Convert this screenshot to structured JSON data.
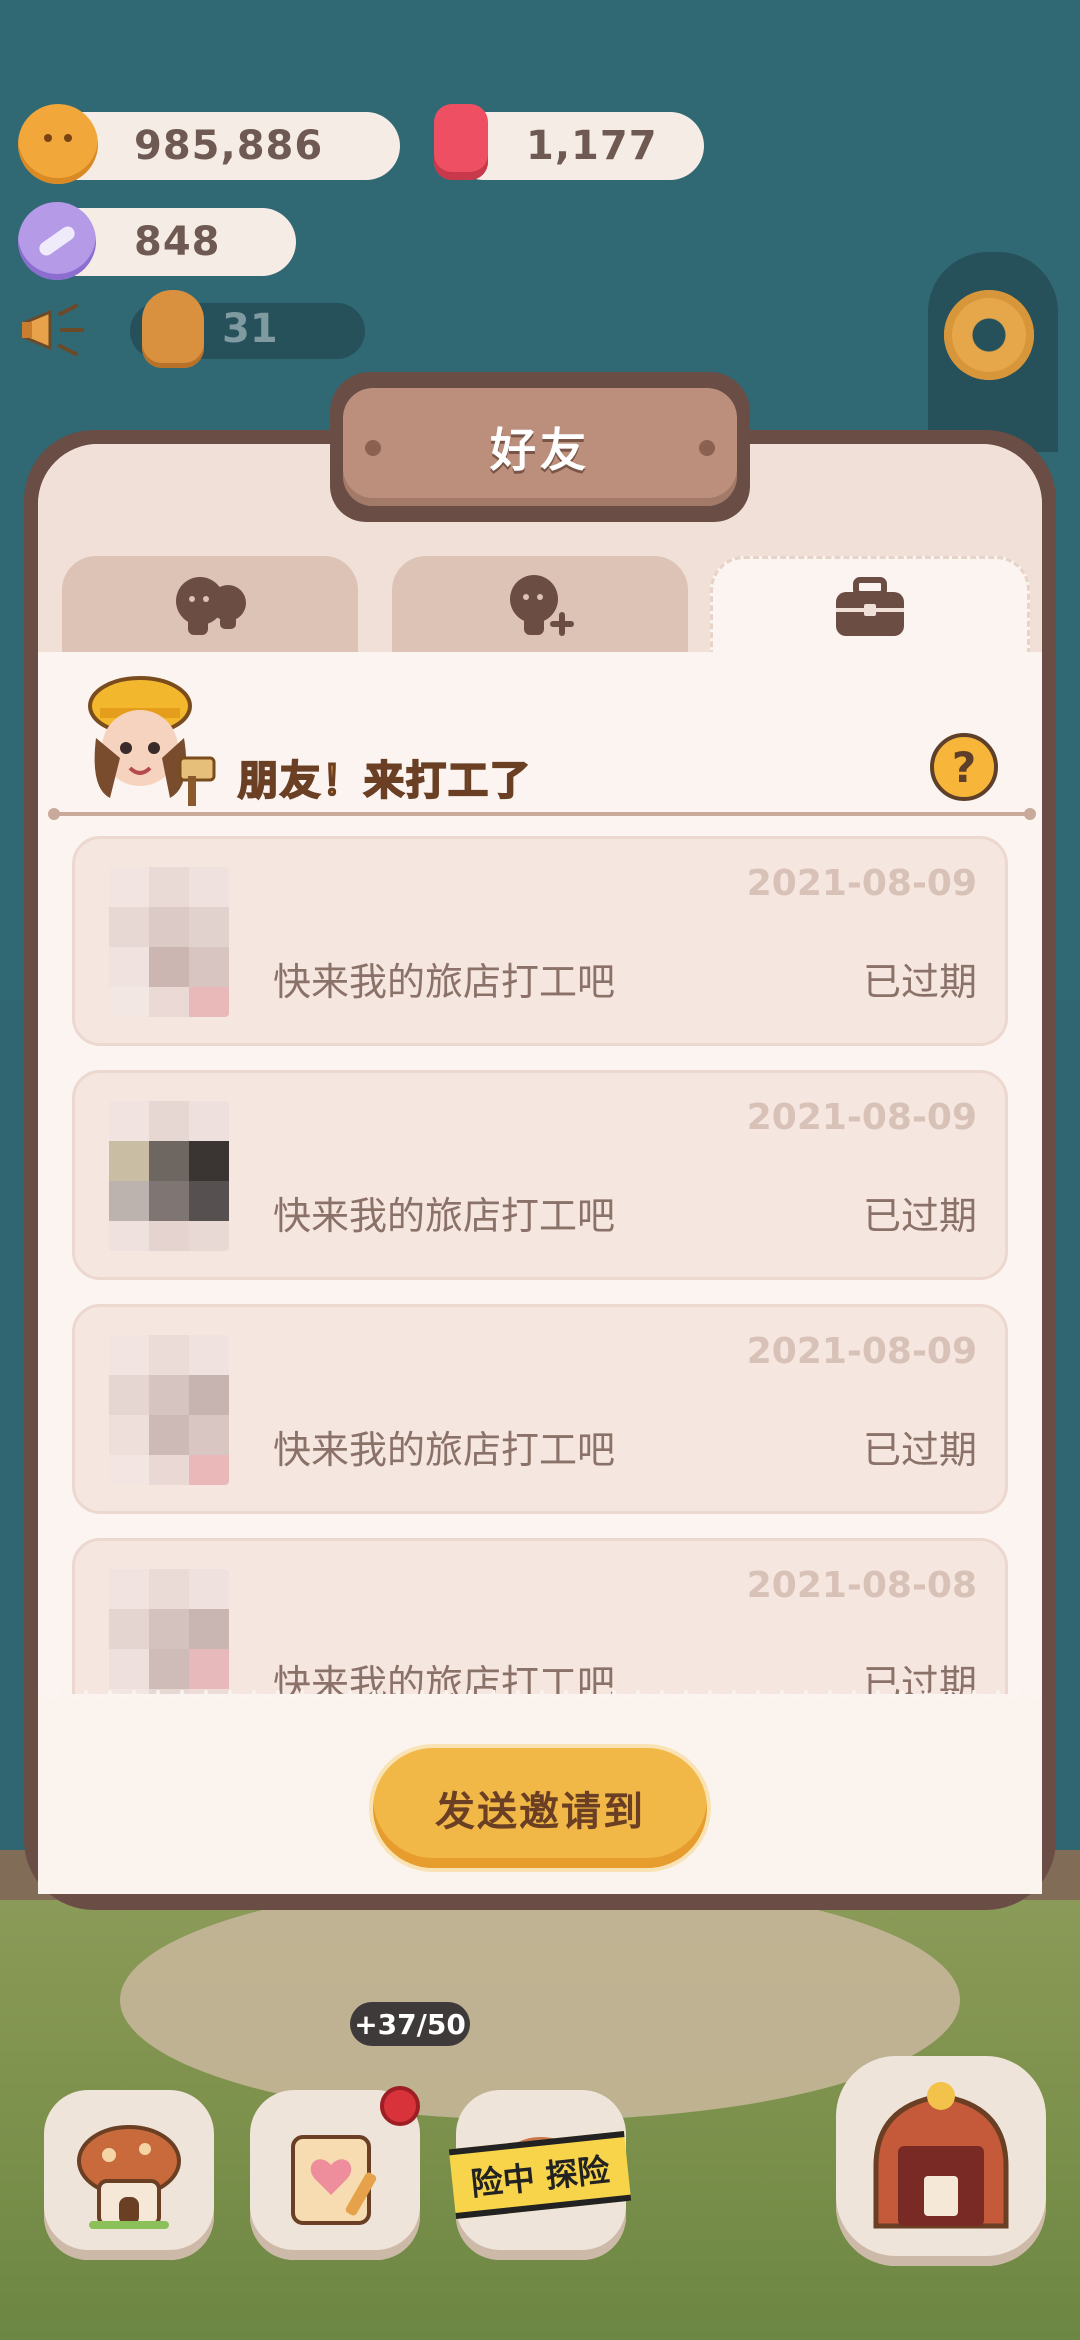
{
  "currencies": {
    "cookies": "985,886",
    "gems": "1,177",
    "candy": "848",
    "notice_count": "31"
  },
  "modal": {
    "title": "好友",
    "tabs": [
      {
        "icon": "friends-icon",
        "active": false
      },
      {
        "icon": "add-friend-icon",
        "active": false
      },
      {
        "icon": "briefcase-icon",
        "active": true
      }
    ],
    "banner_title": "朋友！来打工了",
    "help_label": "?",
    "invites": [
      {
        "date": "2021-08-09",
        "message": "快来我的旅店打工吧",
        "status": "已过期"
      },
      {
        "date": "2021-08-09",
        "message": "快来我的旅店打工吧",
        "status": "已过期"
      },
      {
        "date": "2021-08-09",
        "message": "快来我的旅店打工吧",
        "status": "已过期"
      },
      {
        "date": "2021-08-08",
        "message": "快来我的旅店打工吧",
        "status": "已过期"
      }
    ],
    "send_button": "发送邀请到"
  },
  "bottom_nav": {
    "capacity": "+37/50",
    "tape_text": "险中 探险"
  },
  "colors": {
    "background": "#306874",
    "modal_border": "#6a4d44",
    "button_yellow": "#f2b847",
    "text_brown": "#8b7269"
  }
}
